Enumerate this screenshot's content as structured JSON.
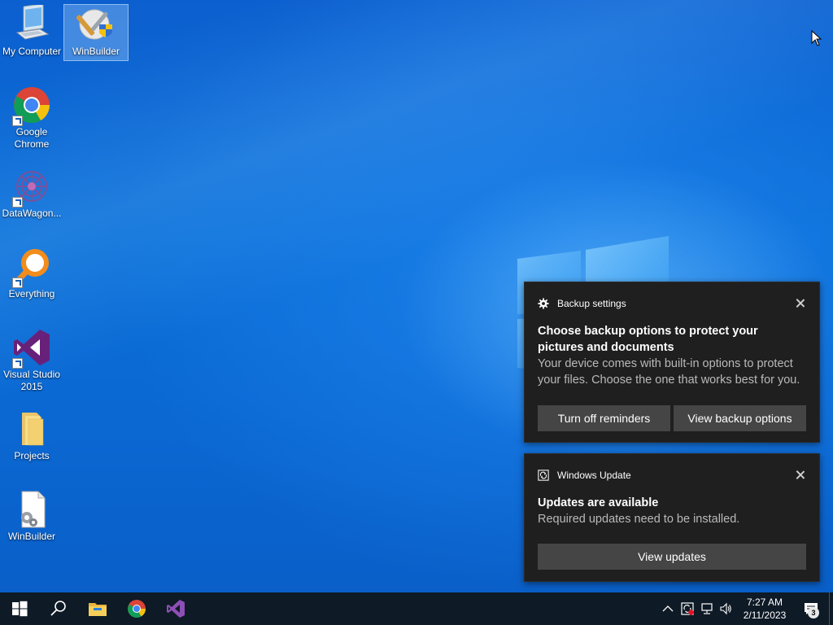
{
  "desktop": {
    "icons": [
      {
        "label": "My Computer",
        "icon": "computer-icon"
      },
      {
        "label": "WinBuilder",
        "icon": "winbuilder-tools-icon",
        "selected": true
      },
      {
        "label": "Google Chrome",
        "icon": "chrome-icon",
        "shortcut": true
      },
      {
        "label": "DataWagon...",
        "icon": "datawagon-icon",
        "shortcut": true
      },
      {
        "label": "Everything",
        "icon": "everything-search-icon",
        "shortcut": true
      },
      {
        "label": "Visual Studio 2015",
        "icon": "visual-studio-icon",
        "shortcut": true
      },
      {
        "label": "Projects",
        "icon": "folder-icon"
      },
      {
        "label": "WinBuilder",
        "icon": "winbuilder-file-icon"
      }
    ]
  },
  "notifications": [
    {
      "app": "Backup settings",
      "icon": "gear-icon",
      "title": "Choose backup options to protect your pictures and documents",
      "body": "Your device comes with built-in options to protect your files. Choose the one that works best for you.",
      "actions": [
        "Turn off reminders",
        "View backup options"
      ]
    },
    {
      "app": "Windows Update",
      "icon": "windows-update-icon",
      "title": "Updates are available",
      "body": "Required updates need to be installed.",
      "actions": [
        "View updates"
      ]
    }
  ],
  "taskbar": {
    "pinned": [
      "start-icon",
      "search-icon",
      "file-explorer-icon",
      "chrome-icon",
      "visual-studio-icon"
    ],
    "clock": {
      "time": "7:27 AM",
      "date": "2/11/2023"
    },
    "notification_count": "3"
  },
  "colors": {
    "toast_bg": "#1f1f1f",
    "toast_button": "#454545",
    "taskbar": "#0e1a26",
    "wallpaper": "#0a63c9"
  }
}
